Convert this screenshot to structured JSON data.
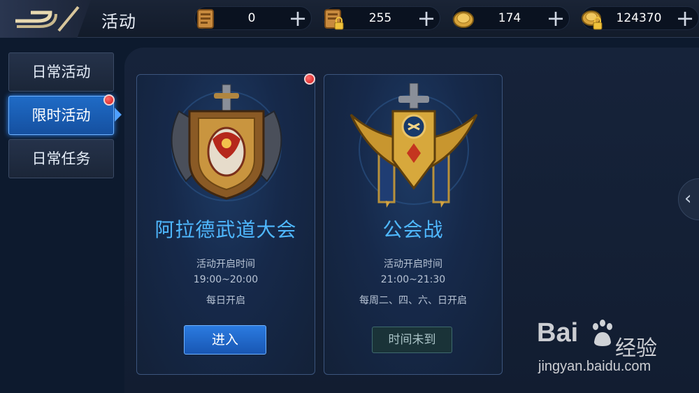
{
  "header": {
    "title": "活动",
    "currencies": [
      {
        "icon": "scroll-icon",
        "value": "0"
      },
      {
        "icon": "locked-scroll-icon",
        "value": "255"
      },
      {
        "icon": "gold-coin-icon",
        "value": "174"
      },
      {
        "icon": "locked-coin-icon",
        "value": "124370"
      }
    ]
  },
  "sidebar": {
    "items": [
      {
        "label": "日常活动"
      },
      {
        "label": "限时活动",
        "active": true,
        "badge": true
      },
      {
        "label": "日常任务"
      }
    ]
  },
  "cards": [
    {
      "title": "阿拉德武道大会",
      "time_label": "活动开启时间",
      "time": "19:00~20:00",
      "schedule": "每日开启",
      "button": "进入",
      "badge": true
    },
    {
      "title": "公会战",
      "time_label": "活动开启时间",
      "time": "21:00~21:30",
      "schedule": "每周二、四、六、日开启",
      "button": "时间未到"
    }
  ],
  "watermark": {
    "brand": "Bai",
    "brand_cn": "经验",
    "url": "jingyan.baidu.com"
  },
  "colors": {
    "accent": "#4fb8ff",
    "active_tab": "#1f6bc6",
    "badge": "#d11a1a"
  }
}
